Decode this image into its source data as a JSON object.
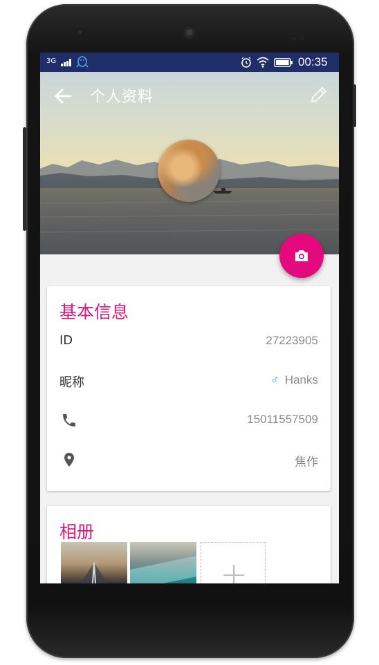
{
  "status_bar": {
    "network": "3G",
    "time": "00:35"
  },
  "toolbar": {
    "title": "个人资料"
  },
  "info_card": {
    "title": "基本信息",
    "rows": [
      {
        "label": "ID",
        "value": "27223905"
      },
      {
        "label": "昵称",
        "value": "Hanks",
        "icon": "male-gender-icon"
      },
      {
        "label": "",
        "value": "15011557509",
        "icon": "phone-icon"
      },
      {
        "label": "",
        "value": "焦作",
        "icon": "location-pin-icon"
      }
    ]
  },
  "album_card": {
    "title": "相册",
    "add_label": "+"
  },
  "colors": {
    "accent": "#e5097f",
    "title_pink": "#d9177d",
    "status_bar": "#1f2d69",
    "gender_blue": "#2aa6de"
  }
}
